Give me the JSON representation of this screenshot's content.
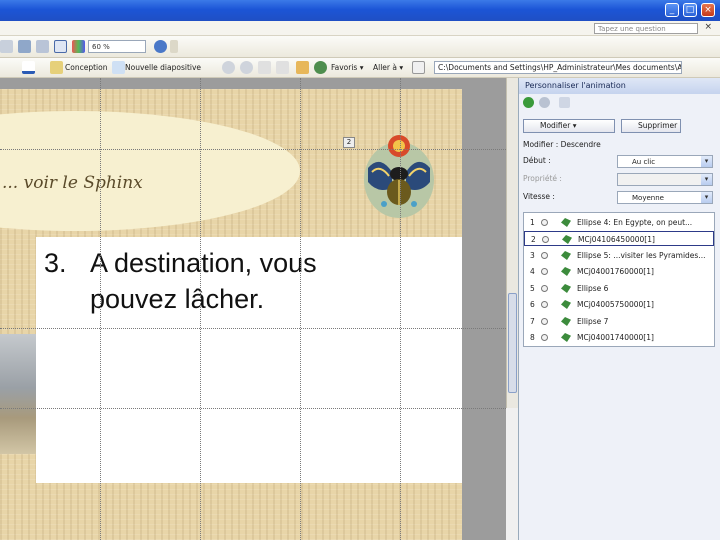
{
  "window": {
    "minimize": "_",
    "maximize": "□",
    "close": "×"
  },
  "menubar": {
    "ask_placeholder": "Tapez une question",
    "close_glyph": "×"
  },
  "toolbar1": {
    "zoom": "60 %"
  },
  "toolbar2": {
    "conception": "Conception",
    "new_slide": "Nouvelle diapositive",
    "favorites": "Favoris ▾",
    "goto": "Aller à ▾",
    "address": "C:\\Documents and Settings\\HP_Administrateur\\Mes documents\\Au"
  },
  "slide": {
    "title_text": "... voir le Sphinx",
    "badge": "2",
    "bullet_number": "3.",
    "bullet_line1": "A destination, vous",
    "bullet_line2": "pouvez lâcher."
  },
  "pane": {
    "title": "Personnaliser l'animation",
    "modify_button": "Modifier ▾",
    "delete_button": "Supprimer",
    "section": "Modifier : Descendre",
    "start_label": "Début :",
    "start_value": "Au clic",
    "property_label": "Propriété :",
    "speed_label": "Vitesse :",
    "speed_value": "Moyenne",
    "animations": [
      {
        "n": "1",
        "text": "Ellipse 4: En Egypte, on peut..."
      },
      {
        "n": "2",
        "text": "MCj04106450000[1]"
      },
      {
        "n": "3",
        "text": "Ellipse 5: ...visiter les Pyramides..."
      },
      {
        "n": "4",
        "text": "MCj04001760000[1]"
      },
      {
        "n": "5",
        "text": "Ellipse 6"
      },
      {
        "n": "6",
        "text": "MCj04005750000[1]"
      },
      {
        "n": "7",
        "text": "Ellipse 7"
      },
      {
        "n": "8",
        "text": "MCj04001740000[1]"
      }
    ]
  },
  "colors": {
    "titlebar": "#1c55d6",
    "selected_border": "#2d3a88",
    "effect_green": "#3c8b3c"
  }
}
